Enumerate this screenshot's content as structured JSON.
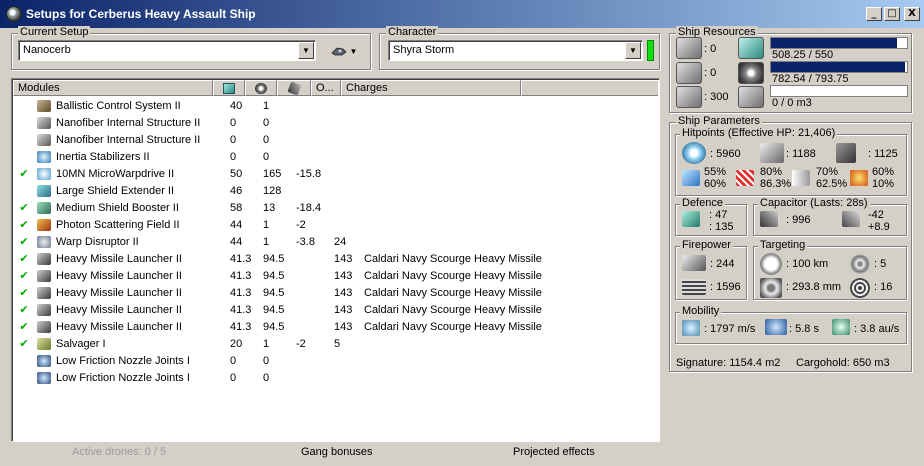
{
  "window": {
    "title": "Setups for Cerberus Heavy Assault Ship",
    "minimize": "_",
    "maximize": "□",
    "close": "X"
  },
  "current_setup": {
    "label": "Current Setup",
    "value": "Nanocerb"
  },
  "character": {
    "label": "Character",
    "value": "Shyra Storm",
    "status_color": "#10e010"
  },
  "modules": {
    "headers": {
      "modules": "Modules",
      "cpu_icon": "cpu-icon",
      "pg_icon": "powergrid-icon",
      "cap_icon": "capacitor-icon",
      "other": "O...",
      "charges": "Charges"
    },
    "rows": [
      {
        "check": "",
        "name": "Ballistic Control System II",
        "cpu": "40",
        "pg": "1",
        "cap": "",
        "other": "",
        "charge": "",
        "icon": "ballistic-control-icon"
      },
      {
        "check": "",
        "name": "Nanofiber Internal Structure II",
        "cpu": "0",
        "pg": "0",
        "cap": "",
        "other": "",
        "charge": "",
        "icon": "nanofiber-icon"
      },
      {
        "check": "",
        "name": "Nanofiber Internal Structure II",
        "cpu": "0",
        "pg": "0",
        "cap": "",
        "other": "",
        "charge": "",
        "icon": "nanofiber-icon"
      },
      {
        "check": "",
        "name": "Inertia Stabilizers II",
        "cpu": "0",
        "pg": "0",
        "cap": "",
        "other": "",
        "charge": "",
        "icon": "inertia-stabilizer-icon"
      },
      {
        "check": "✔",
        "name": "10MN MicroWarpdrive II",
        "cpu": "50",
        "pg": "165",
        "cap": "-15.8",
        "other": "",
        "charge": "",
        "icon": "microwarpdrive-icon"
      },
      {
        "check": "",
        "name": "Large Shield Extender II",
        "cpu": "46",
        "pg": "128",
        "cap": "",
        "other": "",
        "charge": "",
        "icon": "shield-extender-icon"
      },
      {
        "check": "✔",
        "name": "Medium Shield Booster II",
        "cpu": "58",
        "pg": "13",
        "cap": "-18.4",
        "other": "",
        "charge": "",
        "icon": "shield-booster-icon"
      },
      {
        "check": "✔",
        "name": "Photon Scattering Field II",
        "cpu": "44",
        "pg": "1",
        "cap": "-2",
        "other": "",
        "charge": "",
        "icon": "hardener-icon"
      },
      {
        "check": "✔",
        "name": "Warp Disruptor II",
        "cpu": "44",
        "pg": "1",
        "cap": "-3.8",
        "other": "24",
        "charge": "",
        "icon": "warp-disruptor-icon"
      },
      {
        "check": "✔",
        "name": "Heavy Missile Launcher II",
        "cpu": "41.3",
        "pg": "94.5",
        "cap": "",
        "other": "143",
        "charge": "Caldari Navy Scourge Heavy Missile",
        "icon": "missile-launcher-icon"
      },
      {
        "check": "✔",
        "name": "Heavy Missile Launcher II",
        "cpu": "41.3",
        "pg": "94.5",
        "cap": "",
        "other": "143",
        "charge": "Caldari Navy Scourge Heavy Missile",
        "icon": "missile-launcher-icon"
      },
      {
        "check": "✔",
        "name": "Heavy Missile Launcher II",
        "cpu": "41.3",
        "pg": "94.5",
        "cap": "",
        "other": "143",
        "charge": "Caldari Navy Scourge Heavy Missile",
        "icon": "missile-launcher-icon"
      },
      {
        "check": "✔",
        "name": "Heavy Missile Launcher II",
        "cpu": "41.3",
        "pg": "94.5",
        "cap": "",
        "other": "143",
        "charge": "Caldari Navy Scourge Heavy Missile",
        "icon": "missile-launcher-icon"
      },
      {
        "check": "✔",
        "name": "Heavy Missile Launcher II",
        "cpu": "41.3",
        "pg": "94.5",
        "cap": "",
        "other": "143",
        "charge": "Caldari Navy Scourge Heavy Missile",
        "icon": "missile-launcher-icon"
      },
      {
        "check": "✔",
        "name": "Salvager I",
        "cpu": "20",
        "pg": "1",
        "cap": "-2",
        "other": "5",
        "charge": "",
        "icon": "salvager-icon"
      },
      {
        "check": "",
        "name": "Low Friction Nozzle Joints I",
        "cpu": "0",
        "pg": "0",
        "cap": "",
        "other": "",
        "charge": "",
        "icon": "nozzle-joints-icon"
      },
      {
        "check": "",
        "name": "Low Friction Nozzle Joints I",
        "cpu": "0",
        "pg": "0",
        "cap": "",
        "other": "",
        "charge": "",
        "icon": "nozzle-joints-icon"
      }
    ]
  },
  "status_bar": {
    "drones": "Active drones: 0 / 5",
    "gang": "Gang bonuses",
    "projected": "Projected effects"
  },
  "ship_resources": {
    "label": "Ship Resources",
    "turrets": ": 0",
    "launchers": ": 0",
    "calibration": ": 300",
    "cpu": "508.25 / 550",
    "cpu_fraction": 0.924,
    "powergrid": "782.54 / 793.75",
    "powergrid_fraction": 0.986,
    "drone_bay": "0 / 0 m3",
    "drone_bay_fraction": 0
  },
  "ship_parameters": {
    "label": "Ship Parameters",
    "hitpoints": {
      "label": "Hitpoints (Effective HP: 21,406)",
      "shield": ": 5960",
      "armor": ": 1188",
      "structure": ": 1125",
      "em": {
        "top": "55%",
        "bottom": "60%"
      },
      "thermal": {
        "top": "80%",
        "bottom": "86.3%"
      },
      "kinetic": {
        "top": "70%",
        "bottom": "62.5%"
      },
      "explosive": {
        "top": "60%",
        "bottom": "10%"
      }
    },
    "defence": {
      "label": "Defence",
      "top": ": 47",
      "bottom": ": 135"
    },
    "capacitor": {
      "label": "Capacitor (Lasts: 28s)",
      "capacity": ": 996",
      "delta_top": "-42",
      "delta_bottom": "+8.9"
    },
    "firepower": {
      "label": "Firepower",
      "dps": ": 244",
      "volley": ": 1596"
    },
    "targeting": {
      "label": "Targeting",
      "range": ": 100 km",
      "max_targets": ": 5",
      "scan_res": ": 293.8 mm",
      "sensor": ": 16"
    },
    "mobility": {
      "label": "Mobility",
      "speed": ": 1797 m/s",
      "align": ": 5.8 s",
      "warp": ": 3.8 au/s"
    },
    "signature": "Signature: 1154.4 m2",
    "cargohold": "Cargohold: 650 m3"
  }
}
